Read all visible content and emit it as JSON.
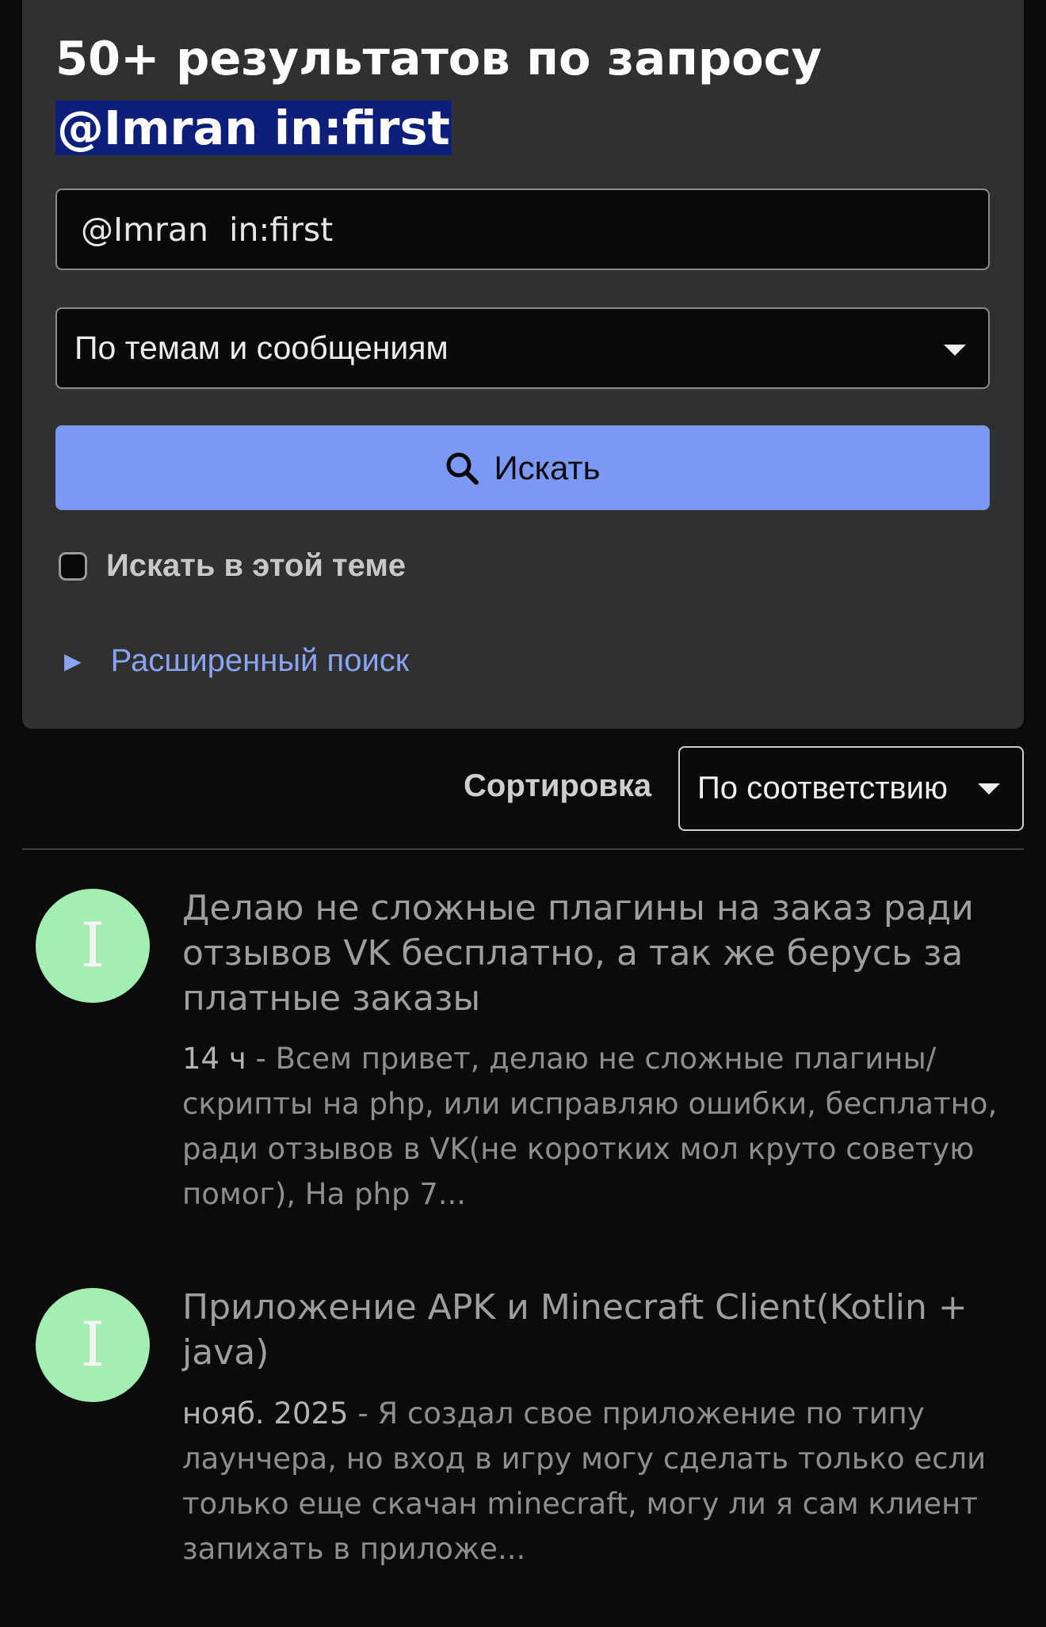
{
  "search": {
    "heading_prefix": "50+ результатов по запросу",
    "heading_query": "@Imran in:first",
    "input_value": "@Imran  in:first",
    "scope_select": "По темам и сообщениям",
    "button_label": "Искать",
    "checkbox_label": "Искать в этой теме",
    "advanced_label": "Расширенный поиск"
  },
  "sort": {
    "label": "Сортировка",
    "selected": "По соответствию"
  },
  "results": [
    {
      "avatar_letter": "I",
      "title": "Делаю не сложные плагины на заказ ради отзывов VK бесплатно, а так же берусь за платные заказы",
      "date": "14 ч",
      "snippet": "Всем привет, делаю не сложные плагины/скрипты на php, или исправляю ошибки, бесплатно, ради отзывов в VK(не коротких мол круто советую помог), На php 7..."
    },
    {
      "avatar_letter": "I",
      "title": "Приложение APK и Minecraft Client(Kotlin + java)",
      "date": "нояб. 2025",
      "snippet": "Я создал свое приложение по типу лаунчера, но вход в игру могу сделать только если только еще скачан minecraft, могу ли я сам клиент запихать в приложе..."
    }
  ],
  "colors": {
    "panel_bg": "#303030",
    "accent": "#7b98f5",
    "query_highlight": "#0d1f7a",
    "avatar_bg": "#a3eeb0"
  }
}
